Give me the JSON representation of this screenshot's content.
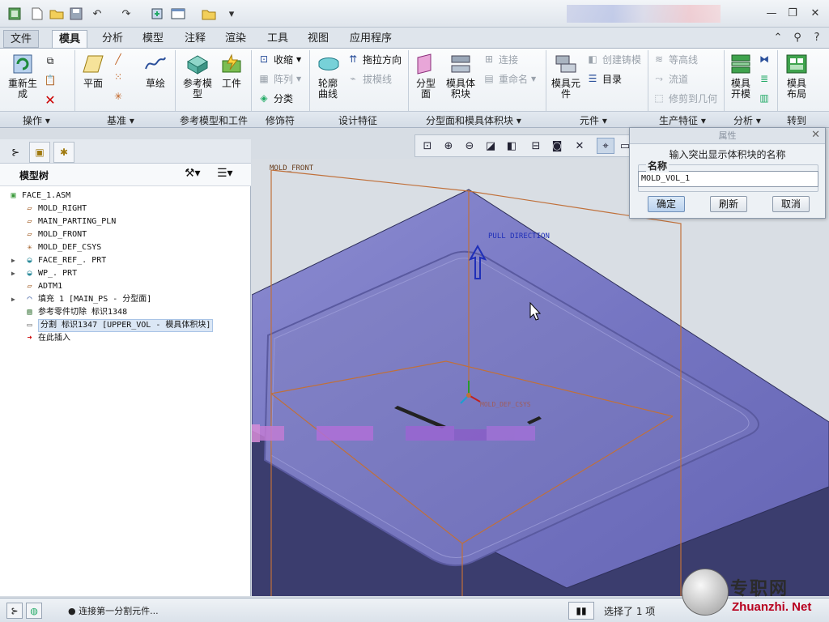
{
  "quick_access": {
    "icons": [
      "app-logo-icon",
      "new-file-icon",
      "open-folder-icon",
      "save-icon",
      "undo-icon",
      "redo-icon",
      "regenerate-icon",
      "window-icon",
      "close-window-icon",
      "customize-icon"
    ]
  },
  "window_controls": {
    "minimize": "—",
    "restore": "❐",
    "close": "✕"
  },
  "menu_tabs": [
    "文件",
    "模具",
    "分析",
    "模型",
    "注释",
    "渲染",
    "工具",
    "视图",
    "应用程序"
  ],
  "active_tab": "模具",
  "ribbon": {
    "regenerate": "重新生\n成",
    "plane": "平面",
    "sketch": "草绘",
    "ref_model": "参考模\n型",
    "workpiece": "工件",
    "shrink": "收缩",
    "pattern": "阵列",
    "classify": "分类",
    "profile_curve": "轮廓\n曲线",
    "drag_direction": "拖拉方向",
    "draft_line": "拔模线",
    "parting_surface": "分型\n面",
    "mold_volume": "模具体\n积块",
    "connect": "连接",
    "rename": "重命名",
    "mold_component": "模具元\n件",
    "create_casting": "创建铸模",
    "directory": "目录",
    "contour": "等高线",
    "runner": "流道",
    "trim_geom": "修剪到几何",
    "mold_open": "模具\n开模",
    "mold_layout": "模具\n布局",
    "groups": [
      "操作",
      "基准",
      "参考模型和工件",
      "修饰符",
      "设计特征",
      "分型面和模具体积块",
      "元件",
      "生产特征",
      "分析",
      "转到"
    ]
  },
  "panel": {
    "title": "模型树",
    "tree": [
      {
        "label": "FACE_1.ASM",
        "icon": "assembly-icon",
        "expand": ""
      },
      {
        "label": "MOLD_RIGHT",
        "icon": "datum-plane-icon",
        "expand": ""
      },
      {
        "label": "MAIN_PARTING_PLN",
        "icon": "datum-plane-icon",
        "expand": ""
      },
      {
        "label": "MOLD_FRONT",
        "icon": "datum-plane-icon",
        "expand": ""
      },
      {
        "label": "MOLD_DEF_CSYS",
        "icon": "csys-icon",
        "expand": ""
      },
      {
        "label": "FACE_REF_. PRT",
        "icon": "part-icon",
        "expand": "▶"
      },
      {
        "label": "WP_. PRT",
        "icon": "part-icon",
        "expand": "▶"
      },
      {
        "label": "ADTM1",
        "icon": "datum-plane-icon",
        "expand": ""
      },
      {
        "label": "填充 1 [MAIN_PS - 分型面]",
        "icon": "fill-surface-icon",
        "expand": "▶"
      },
      {
        "label": "参考零件切除 标识1348",
        "icon": "cut-icon",
        "expand": ""
      },
      {
        "label": "分割 标识1347 [UPPER_VOL - 模具体积块]",
        "icon": "split-icon",
        "expand": "",
        "selected": true
      },
      {
        "label": "在此插入",
        "icon": "insert-arrow-icon",
        "expand": ""
      }
    ]
  },
  "viewport": {
    "mold_front_label": "MOLD_FRONT",
    "pull_direction_label": "PULL DIRECTION",
    "csys_label": "MOLD_DEF_CSYS"
  },
  "dialog": {
    "title": "属性",
    "prompt": "输入突出显示体积块的名称",
    "name_label": "名称",
    "name_value": "MOLD_VOL_1",
    "ok": "确定",
    "refresh": "刷新",
    "cancel": "取消"
  },
  "status": {
    "message": "● 连接第一分割元件...",
    "selection": "选择了 1 项"
  },
  "watermark": {
    "text": "专职网",
    "url": "Zhuanzhi. Net"
  },
  "colors": {
    "model_face": "#7a7ac4",
    "model_dark": "#3d3f70",
    "plane_edges": "#c0703a",
    "pull_arrow": "#2233cc"
  }
}
